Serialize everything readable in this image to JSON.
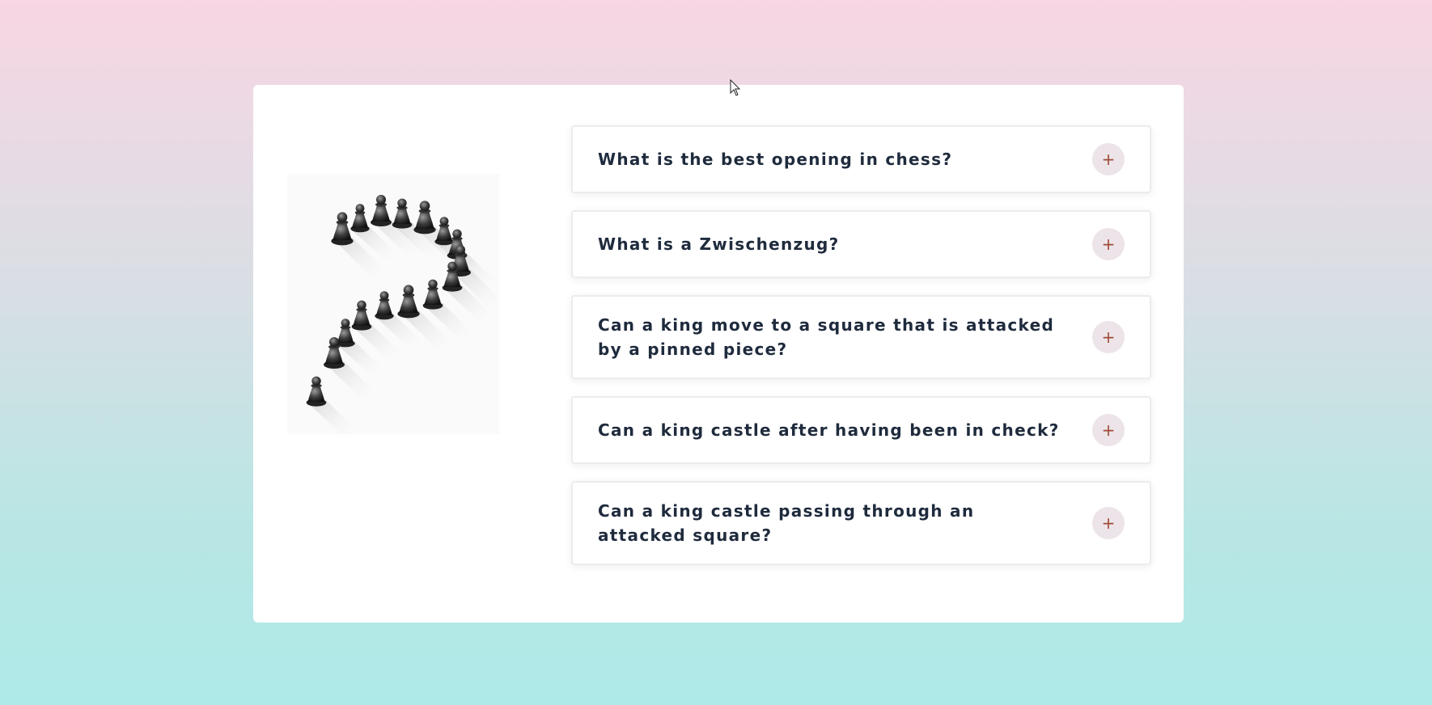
{
  "faq": {
    "items": [
      {
        "question": "What is the best opening in chess?",
        "toggle_symbol": "+"
      },
      {
        "question": "What is a Zwischenzug?",
        "toggle_symbol": "+"
      },
      {
        "question": "Can a king move to a square that is attacked by a pinned piece?",
        "toggle_symbol": "+"
      },
      {
        "question": "Can a king castle after having been in check?",
        "toggle_symbol": "+"
      },
      {
        "question": "Can a king castle passing through an attacked square?",
        "toggle_symbol": "+"
      }
    ]
  },
  "illustration": {
    "icon": "chess-question-mark-image"
  },
  "colors": {
    "background_top": "#f8d6e3",
    "background_bottom": "#aeeae8",
    "question_text": "#1f2b3d",
    "toggle_bg": "#ece4e8",
    "toggle_icon": "#a04a38"
  }
}
